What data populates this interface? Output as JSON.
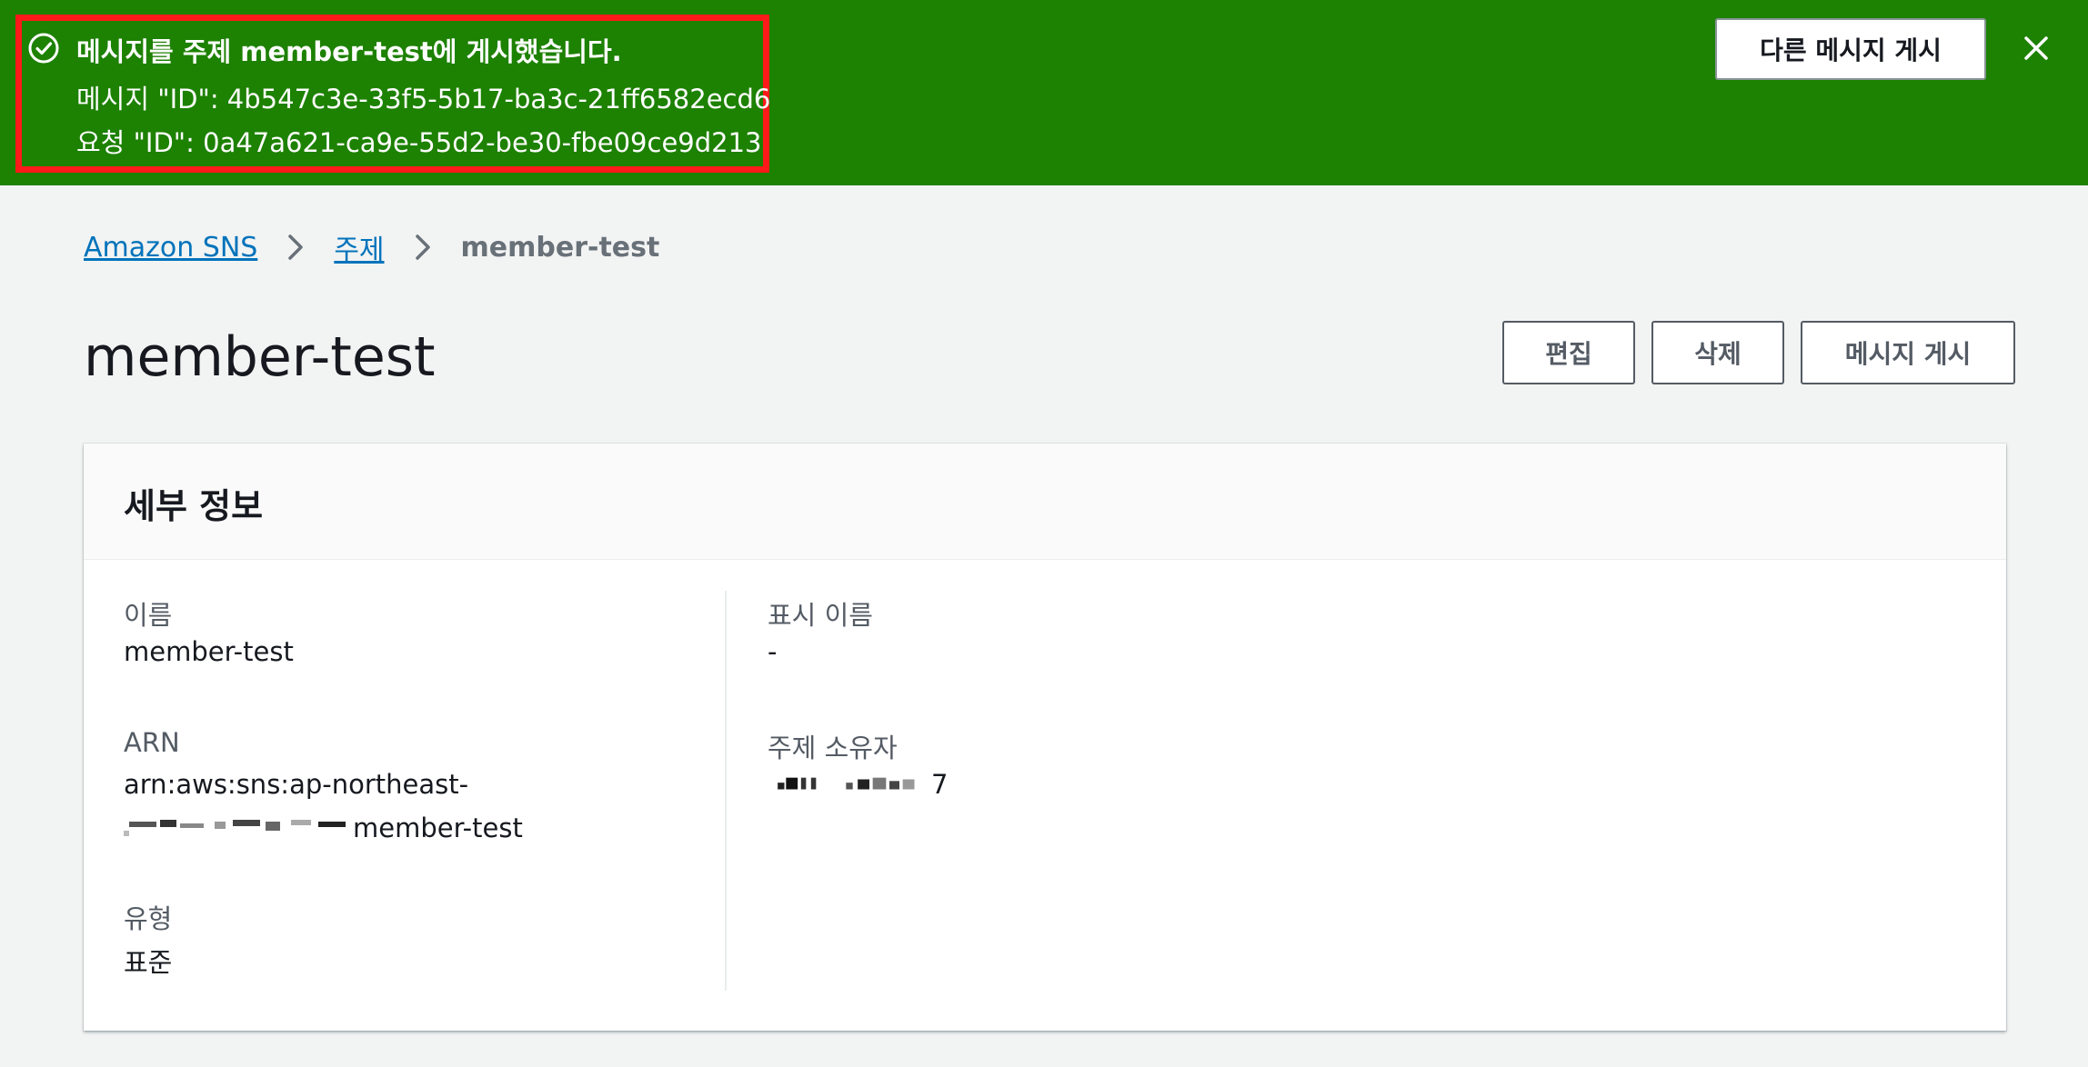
{
  "flash": {
    "title": "메시지를 주제 member-test에 게시했습니다.",
    "message_id_line": "메시지 \"ID\": 4b547c3e-33f5-5b17-ba3c-21ff6582ecd6",
    "request_id_line": "요청 \"ID\": 0a47a621-ca9e-55d2-be30-fbe09ce9d213",
    "publish_another_label": "다른 메시지 게시",
    "close_icon": "close-icon",
    "status_icon": "check-circle-icon",
    "color": "#1d8102",
    "highlight_color": "#ff1a1a"
  },
  "breadcrumb": {
    "items": [
      "Amazon SNS",
      "주제"
    ],
    "current": "member-test"
  },
  "page": {
    "title": "member-test",
    "actions": {
      "edit_label": "편집",
      "delete_label": "삭제",
      "publish_label": "메시지 게시"
    }
  },
  "details": {
    "header": "세부 정보",
    "name_label": "이름",
    "name_value": "member-test",
    "arn_label": "ARN",
    "arn_value_line1": "arn:aws:sns:ap-northeast-",
    "arn_value_line2_suffix": "member-test",
    "type_label": "유형",
    "type_value": "표준",
    "display_name_label": "표시 이름",
    "display_name_value": "-",
    "owner_label": "주제 소유자",
    "owner_value_suffix": "7"
  }
}
